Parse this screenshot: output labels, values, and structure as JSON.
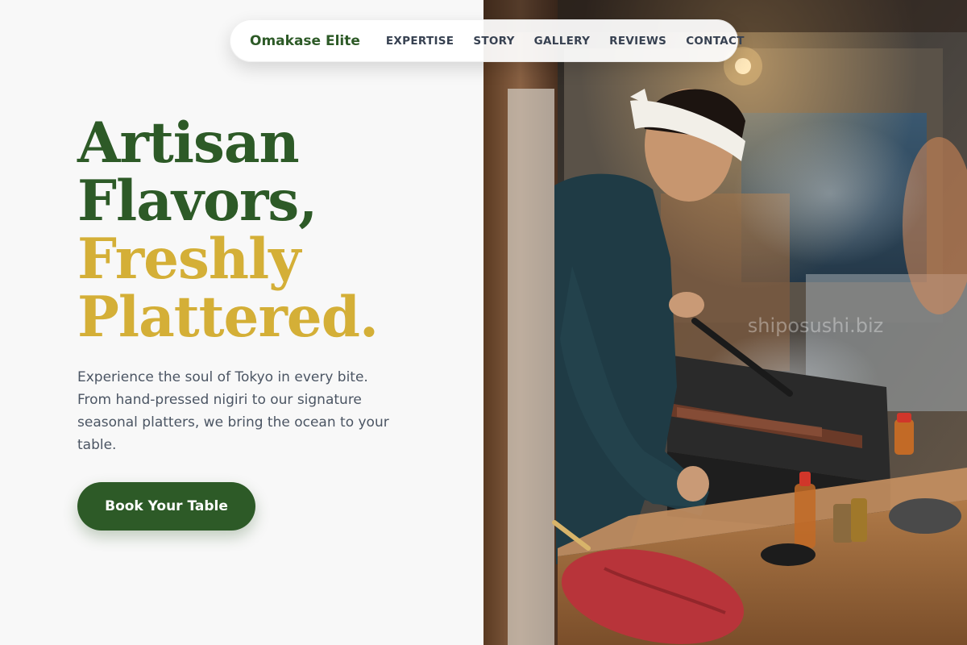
{
  "nav": {
    "brand": "Omakase Elite",
    "links": [
      {
        "label": "EXPERTISE"
      },
      {
        "label": "STORY"
      },
      {
        "label": "GALLERY"
      },
      {
        "label": "REVIEWS"
      },
      {
        "label": "CONTACT"
      }
    ]
  },
  "hero": {
    "headline_lines": [
      "Artisan",
      "Flavors,",
      "Freshly",
      "Plattered."
    ],
    "description": "Experience the soul of Tokyo in every bite. From hand-pressed nigiri to our signature seasonal platters, we bring the ocean to your table.",
    "cta_label": "Book Your Table"
  },
  "image": {
    "alt": "Chef wearing a white headband grilling skewers over charcoal",
    "watermark": "shiposushi.biz"
  },
  "colors": {
    "brand_green": "#2d5a27",
    "accent_gold": "#d4af37",
    "text_gray": "#4b5563",
    "nav_text": "#374151",
    "background": "#f8f8f8"
  }
}
